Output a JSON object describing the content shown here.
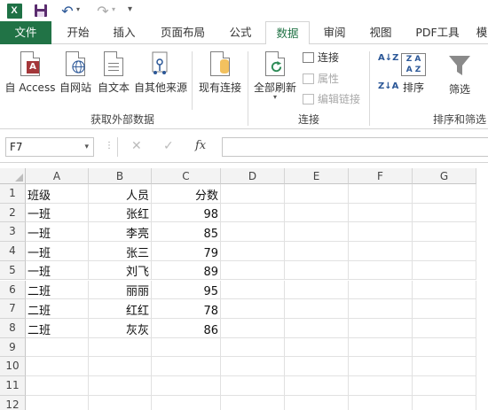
{
  "quick_access": {
    "app": "X"
  },
  "tabs": [
    "文件",
    "开始",
    "插入",
    "页面布局",
    "公式",
    "数据",
    "审阅",
    "视图",
    "PDF工具",
    "模"
  ],
  "ribbon": {
    "get_external": {
      "buttons": [
        "自 Access",
        "自网站",
        "自文本",
        "自其他来源",
        "现有连接"
      ],
      "label": "获取外部数据"
    },
    "connections": {
      "refresh_all": "全部刷新",
      "connections": "连接",
      "properties": "属性",
      "edit_links": "编辑链接",
      "label": "连接"
    },
    "sort_filter": {
      "sort": "排序",
      "filter": "筛选",
      "label": "排序和筛选",
      "az": "A↓Z",
      "za": "Z↓A"
    }
  },
  "formula_bar": {
    "name_box": "F7",
    "fx": "fx",
    "value": ""
  },
  "sheet": {
    "columns": [
      "A",
      "B",
      "C",
      "D",
      "E",
      "F",
      "G"
    ],
    "rows": [
      "1",
      "2",
      "3",
      "4",
      "5",
      "6",
      "7",
      "8",
      "9",
      "10",
      "11",
      "12"
    ],
    "cells": [
      [
        "班级",
        "人员",
        "分数"
      ],
      [
        "一班",
        "张红",
        "98"
      ],
      [
        "一班",
        "李亮",
        "85"
      ],
      [
        "一班",
        "张三",
        "79"
      ],
      [
        "一班",
        "刘飞",
        "89"
      ],
      [
        "二班",
        "丽丽",
        "95"
      ],
      [
        "二班",
        "红红",
        "78"
      ],
      [
        "二班",
        "灰灰",
        "86"
      ]
    ]
  },
  "colors": {
    "excel_green": "#217346",
    "accent_blue": "#2b5797"
  }
}
